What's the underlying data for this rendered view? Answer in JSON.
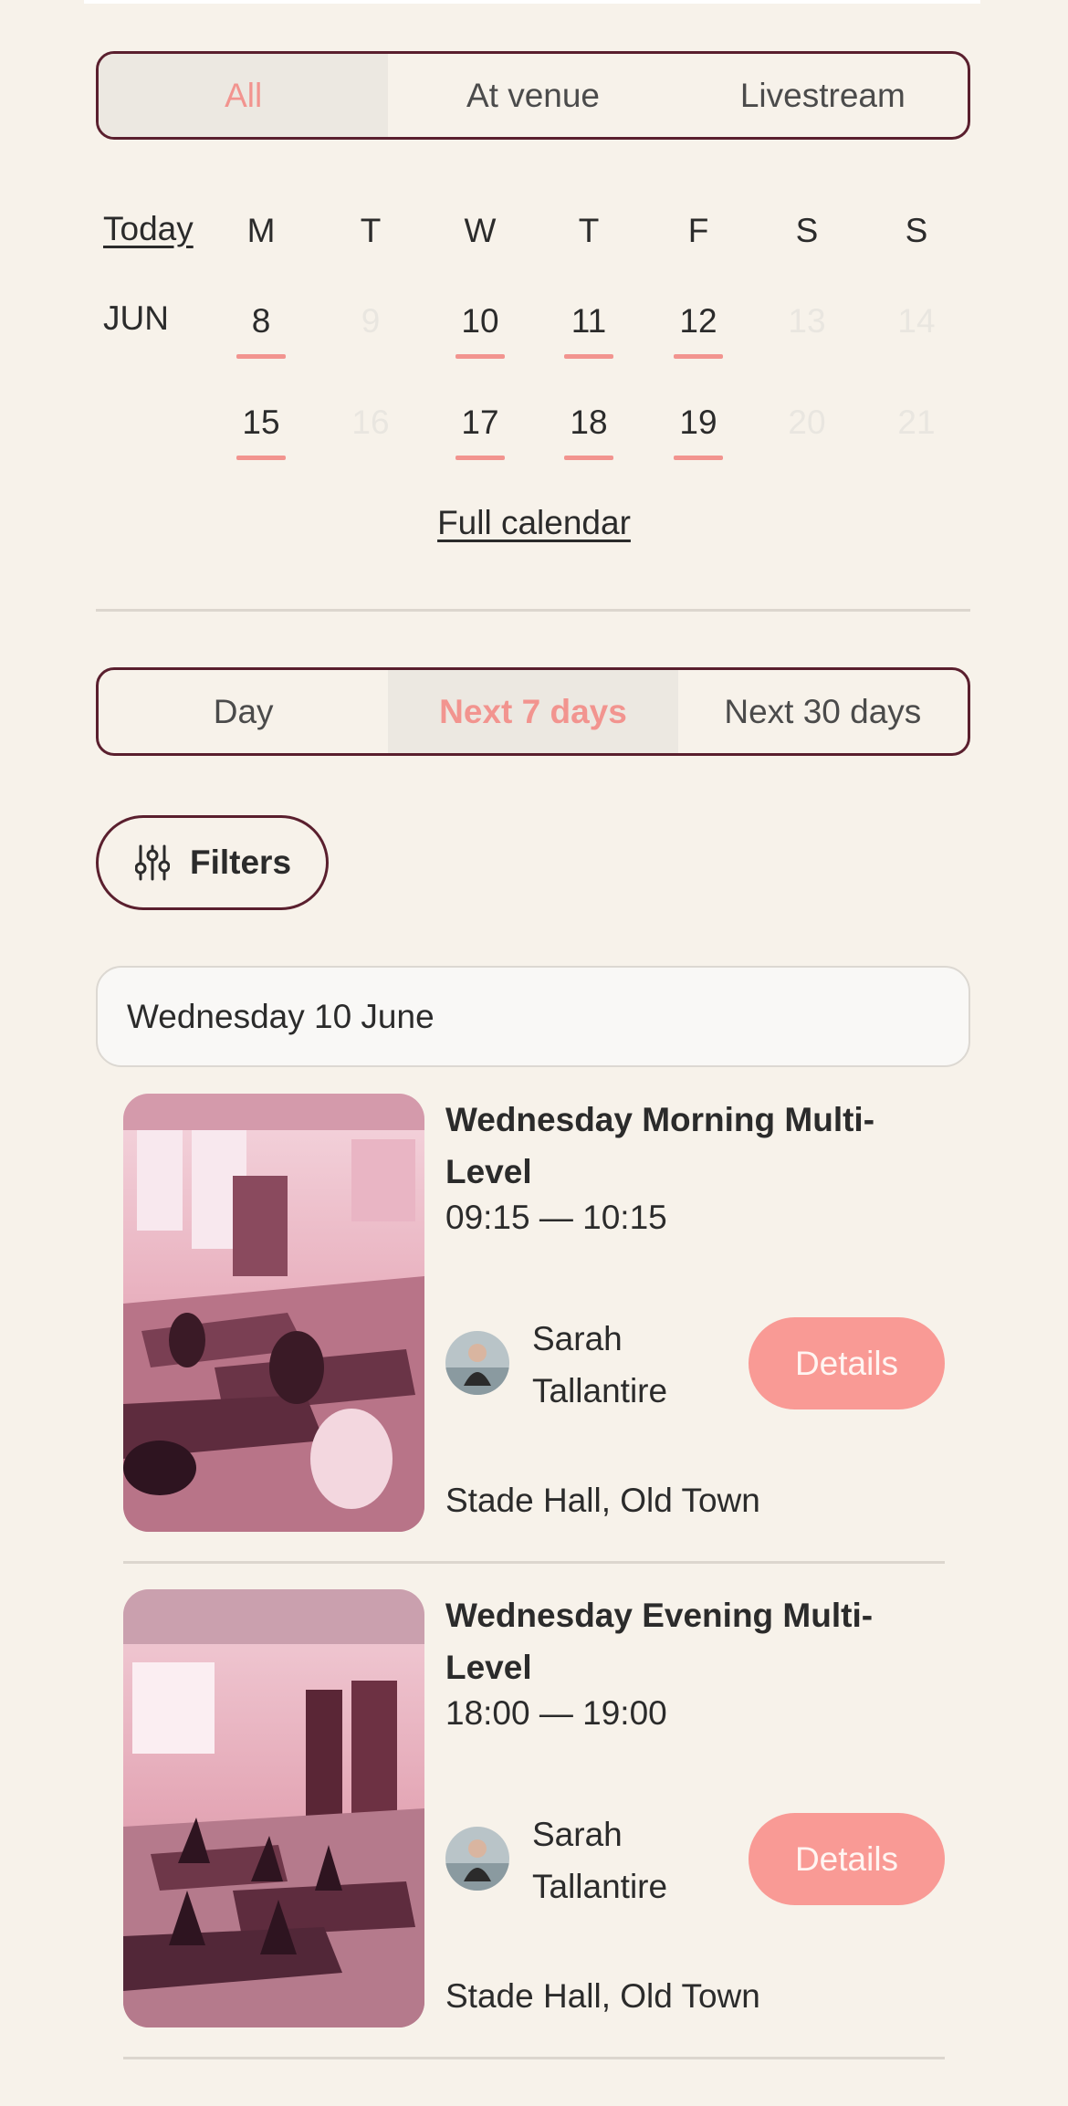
{
  "location_filter": {
    "options": [
      "All",
      "At venue",
      "Livestream"
    ],
    "selected": "All"
  },
  "calendar": {
    "today_label": "Today",
    "month_label": "JUN",
    "weekday_headers": [
      "M",
      "T",
      "W",
      "T",
      "F",
      "S",
      "S"
    ],
    "weeks": [
      [
        {
          "day": "8",
          "available": true
        },
        {
          "day": "9",
          "available": false
        },
        {
          "day": "10",
          "available": true
        },
        {
          "day": "11",
          "available": true
        },
        {
          "day": "12",
          "available": true
        },
        {
          "day": "13",
          "available": false
        },
        {
          "day": "14",
          "available": false
        }
      ],
      [
        {
          "day": "15",
          "available": true
        },
        {
          "day": "16",
          "available": false
        },
        {
          "day": "17",
          "available": true
        },
        {
          "day": "18",
          "available": true
        },
        {
          "day": "19",
          "available": true
        },
        {
          "day": "20",
          "available": false
        },
        {
          "day": "21",
          "available": false
        }
      ]
    ],
    "full_calendar_label": "Full calendar"
  },
  "range_filter": {
    "options": [
      "Day",
      "Next 7 days",
      "Next 30 days"
    ],
    "selected": "Next 7 days"
  },
  "filters_button": {
    "label": "Filters",
    "icon": "sliders-icon"
  },
  "date_header": "Wednesday 10 June",
  "classes": [
    {
      "title": "Wednesday Morning Multi-Level",
      "time": "09:15 — 10:15",
      "teacher": "Sarah Tallantire",
      "details_label": "Details",
      "venue": "Stade Hall, Old Town"
    },
    {
      "title": "Wednesday Evening Multi-Level",
      "time": "18:00 — 19:00",
      "teacher": "Sarah Tallantire",
      "details_label": "Details",
      "venue": "Stade Hall, Old Town"
    }
  ],
  "colors": {
    "background": "#f7f2ea",
    "accent": "#f2948f",
    "button": "#f99a95",
    "border": "#5a1f2e",
    "selected_bg": "#ece8e1"
  }
}
